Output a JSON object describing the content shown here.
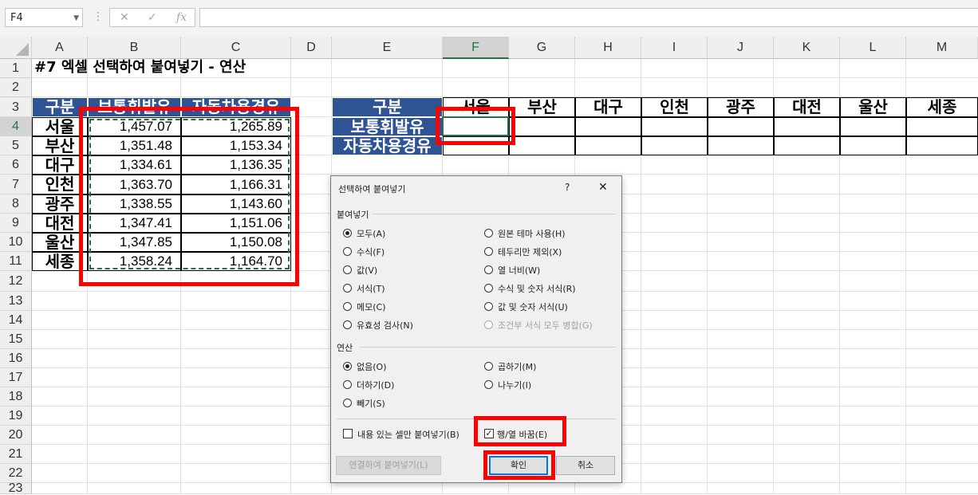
{
  "formula_bar": {
    "name_box": "F4",
    "cancel_icon": "✕",
    "enter_icon": "✓",
    "fx_label": "fx",
    "formula": ""
  },
  "columns": [
    "A",
    "B",
    "C",
    "D",
    "E",
    "F",
    "G",
    "H",
    "I",
    "J",
    "K",
    "L",
    "M"
  ],
  "rows": [
    "1",
    "2",
    "3",
    "4",
    "5",
    "6",
    "7",
    "8",
    "9",
    "10",
    "11",
    "12",
    "13",
    "14",
    "15",
    "16",
    "17",
    "18",
    "19",
    "20",
    "21",
    "22",
    "23"
  ],
  "sheet": {
    "title": "#7 엑셀 선택하여 붙여넣기 - 연산",
    "left_table": {
      "headers": [
        "구분",
        "보통휘발유",
        "자동차용경유"
      ],
      "rows": [
        {
          "city": "서울",
          "gas": "1,457.07",
          "diesel": "1,265.89"
        },
        {
          "city": "부산",
          "gas": "1,351.48",
          "diesel": "1,153.34"
        },
        {
          "city": "대구",
          "gas": "1,334.61",
          "diesel": "1,136.35"
        },
        {
          "city": "인천",
          "gas": "1,363.70",
          "diesel": "1,166.31"
        },
        {
          "city": "광주",
          "gas": "1,338.55",
          "diesel": "1,143.60"
        },
        {
          "city": "대전",
          "gas": "1,347.41",
          "diesel": "1,151.06"
        },
        {
          "city": "울산",
          "gas": "1,347.85",
          "diesel": "1,150.08"
        },
        {
          "city": "세종",
          "gas": "1,358.24",
          "diesel": "1,164.70"
        }
      ]
    },
    "right_table": {
      "corner": "구분",
      "cities": [
        "서울",
        "부산",
        "대구",
        "인천",
        "광주",
        "대전",
        "울산",
        "세종"
      ],
      "row_labels": [
        "보통휘발유",
        "자동차용경유"
      ]
    }
  },
  "dialog": {
    "title": "선택하여 붙여넣기",
    "help": "?",
    "close": "✕",
    "paste_group": "붙여넣기",
    "paste_options_left": [
      "모두(A)",
      "수식(F)",
      "값(V)",
      "서식(T)",
      "메모(C)",
      "유효성 검사(N)"
    ],
    "paste_options_right": [
      "원본 테마 사용(H)",
      "테두리만 제외(X)",
      "열 너비(W)",
      "수식 및 숫자 서식(R)",
      "값 및 숫자 서식(U)",
      "조건부 서식 모두 병합(G)"
    ],
    "operation_group": "연산",
    "operation_left": [
      "없음(O)",
      "더하기(D)",
      "빼기(S)"
    ],
    "operation_right": [
      "곱하기(M)",
      "나누기(I)"
    ],
    "skip_blanks": "내용 있는 셀만 붙여넣기(B)",
    "transpose": "행/열 바꿈(E)",
    "paste_link": "연결하여 붙여넣기(L)",
    "ok": "확인",
    "cancel": "취소"
  },
  "colors": {
    "header_blue": "#2f5496",
    "highlight_red": "#ff0000",
    "excel_green": "#217346"
  }
}
